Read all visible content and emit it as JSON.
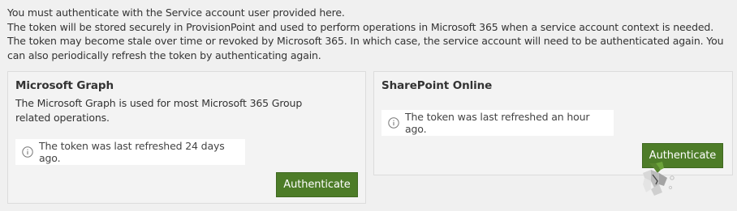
{
  "intro": {
    "line1": "You must authenticate with the Service account user provided here.",
    "line2": "The token will be stored securely in ProvisionPoint and used to perform operations in Microsoft 365 when a service account context is needed.",
    "line3": "The token may become stale over time or revoked by Microsoft 365. In which case, the service account will need to be authenticated again. You can also periodically refresh the token by authenticating again."
  },
  "graph": {
    "title": "Microsoft Graph",
    "description": "The Microsoft Graph is used for most Microsoft 365 Group related operations.",
    "status": "The token was last refreshed 24 days ago.",
    "button": "Authenticate"
  },
  "sharepoint": {
    "title": "SharePoint Online",
    "status": "The token was last refreshed an hour ago.",
    "button": "Authenticate"
  },
  "colors": {
    "button": "#4d7c28",
    "background": "#f0f0f0",
    "card": "#f3f3f3",
    "status_box": "#ffffff"
  },
  "icons": {
    "status": "info-circle-icon",
    "watermark": "watermark-logo-icon"
  }
}
